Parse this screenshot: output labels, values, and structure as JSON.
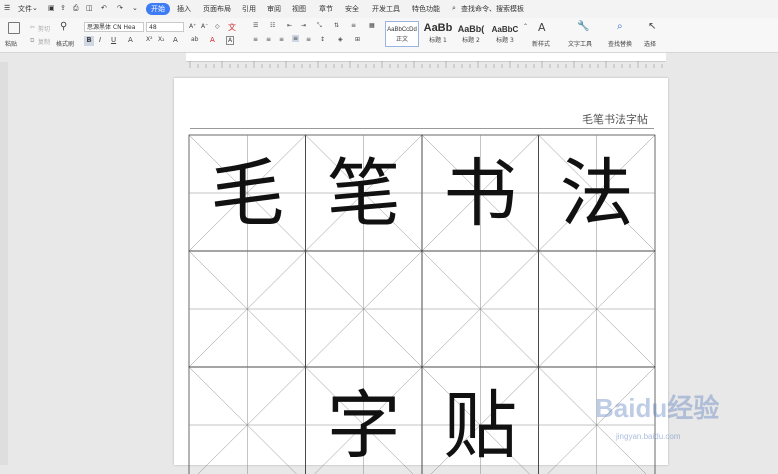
{
  "menubar": {
    "file": "文件",
    "tabs": [
      {
        "label": "开始",
        "active": true
      },
      {
        "label": "插入"
      },
      {
        "label": "页面布局"
      },
      {
        "label": "引用"
      },
      {
        "label": "审阅"
      },
      {
        "label": "视图"
      },
      {
        "label": "章节"
      },
      {
        "label": "安全"
      },
      {
        "label": "开发工具"
      },
      {
        "label": "特色功能"
      }
    ],
    "search": "查找命令、搜索模板"
  },
  "ribbon": {
    "paste": "粘贴",
    "cut": "剪切",
    "copy": "复制",
    "format_painter": "格式刷",
    "font_name": "思源黑体 CN Hea",
    "font_size": "48",
    "styles": [
      {
        "sample": "AaBbCcDd",
        "name": "正文"
      },
      {
        "sample": "AaBb",
        "name": "标题 1"
      },
      {
        "sample": "AaBb(",
        "name": "标题 2"
      },
      {
        "sample": "AaBbC",
        "name": "标题 3"
      }
    ],
    "new_style": "新样式",
    "text_tools": "文字工具",
    "find_replace": "查找替换",
    "select": "选择"
  },
  "document": {
    "header": "毛笔书法字帖",
    "characters": [
      "毛",
      "笔",
      "书",
      "法",
      "",
      "",
      "",
      "",
      "",
      "字",
      "贴",
      ""
    ]
  },
  "watermark": {
    "brand": "Baidu经验",
    "url": "jingyan.baidu.com"
  }
}
